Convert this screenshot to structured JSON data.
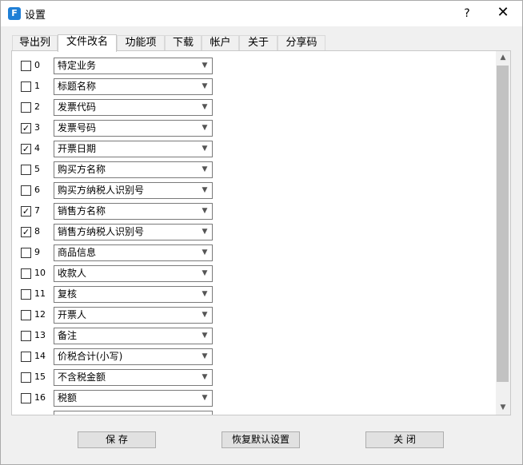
{
  "window": {
    "title": "设置",
    "icon_letter": "F",
    "help_label": "?",
    "close_label": "✕"
  },
  "tabs": [
    {
      "label": "导出列"
    },
    {
      "label": "文件改名"
    },
    {
      "label": "功能项"
    },
    {
      "label": "下载"
    },
    {
      "label": "帐户"
    },
    {
      "label": "关于"
    },
    {
      "label": "分享码"
    }
  ],
  "active_tab": 1,
  "rows": [
    {
      "num": "0",
      "value": "特定业务",
      "checked": false
    },
    {
      "num": "1",
      "value": "标题名称",
      "checked": false
    },
    {
      "num": "2",
      "value": "发票代码",
      "checked": false
    },
    {
      "num": "3",
      "value": "发票号码",
      "checked": true
    },
    {
      "num": "4",
      "value": "开票日期",
      "checked": true
    },
    {
      "num": "5",
      "value": "购买方名称",
      "checked": false
    },
    {
      "num": "6",
      "value": "购买方纳税人识别号",
      "checked": false
    },
    {
      "num": "7",
      "value": "销售方名称",
      "checked": true
    },
    {
      "num": "8",
      "value": "销售方纳税人识别号",
      "checked": true
    },
    {
      "num": "9",
      "value": "商品信息",
      "checked": false
    },
    {
      "num": "10",
      "value": "收款人",
      "checked": false
    },
    {
      "num": "11",
      "value": "复核",
      "checked": false
    },
    {
      "num": "12",
      "value": "开票人",
      "checked": false
    },
    {
      "num": "13",
      "value": "备注",
      "checked": false
    },
    {
      "num": "14",
      "value": "价税合计(小写)",
      "checked": false
    },
    {
      "num": "15",
      "value": "不含税金额",
      "checked": false
    },
    {
      "num": "16",
      "value": "税额",
      "checked": false
    }
  ],
  "scroll_position": 0.0,
  "buttons": {
    "save": "保 存",
    "restore": "恢复默认设置",
    "close": "关 闭"
  },
  "colors": {
    "window_bg": "#f0f0f0",
    "panel_bg": "#ffffff",
    "scroll_thumb": "#c2c2c2",
    "app_icon": "#1f7fd6"
  }
}
